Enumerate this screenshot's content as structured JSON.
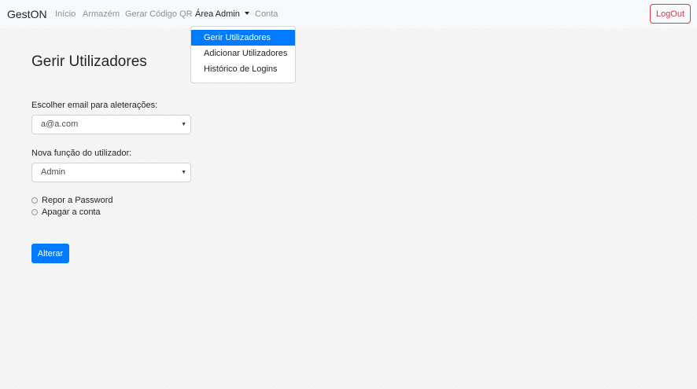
{
  "navbar": {
    "brand": "GestON",
    "links": [
      {
        "label": "Início"
      },
      {
        "label": "Armazém"
      },
      {
        "label": "Gerar Código QR"
      },
      {
        "label": "Área Admin"
      },
      {
        "label": "Conta"
      }
    ],
    "logout_label": "LogOut"
  },
  "dropdown": {
    "items": [
      {
        "label": "Gerir Utilizadores",
        "active": true
      },
      {
        "label": "Adicionar Utilizadores"
      },
      {
        "label": "Histórico de Logins"
      }
    ]
  },
  "main": {
    "title": "Gerir Utilizadores",
    "email_label": "Escolher email para aleterações:",
    "email_value": "a@a.com",
    "role_label": "Nova função do utilizador:",
    "role_value": "Admin",
    "options": [
      {
        "label": "Repor a Password"
      },
      {
        "label": "Apagar a conta"
      }
    ],
    "submit_label": "Alterar"
  },
  "colors": {
    "accent": "#007bff",
    "danger": "#dc3545"
  }
}
